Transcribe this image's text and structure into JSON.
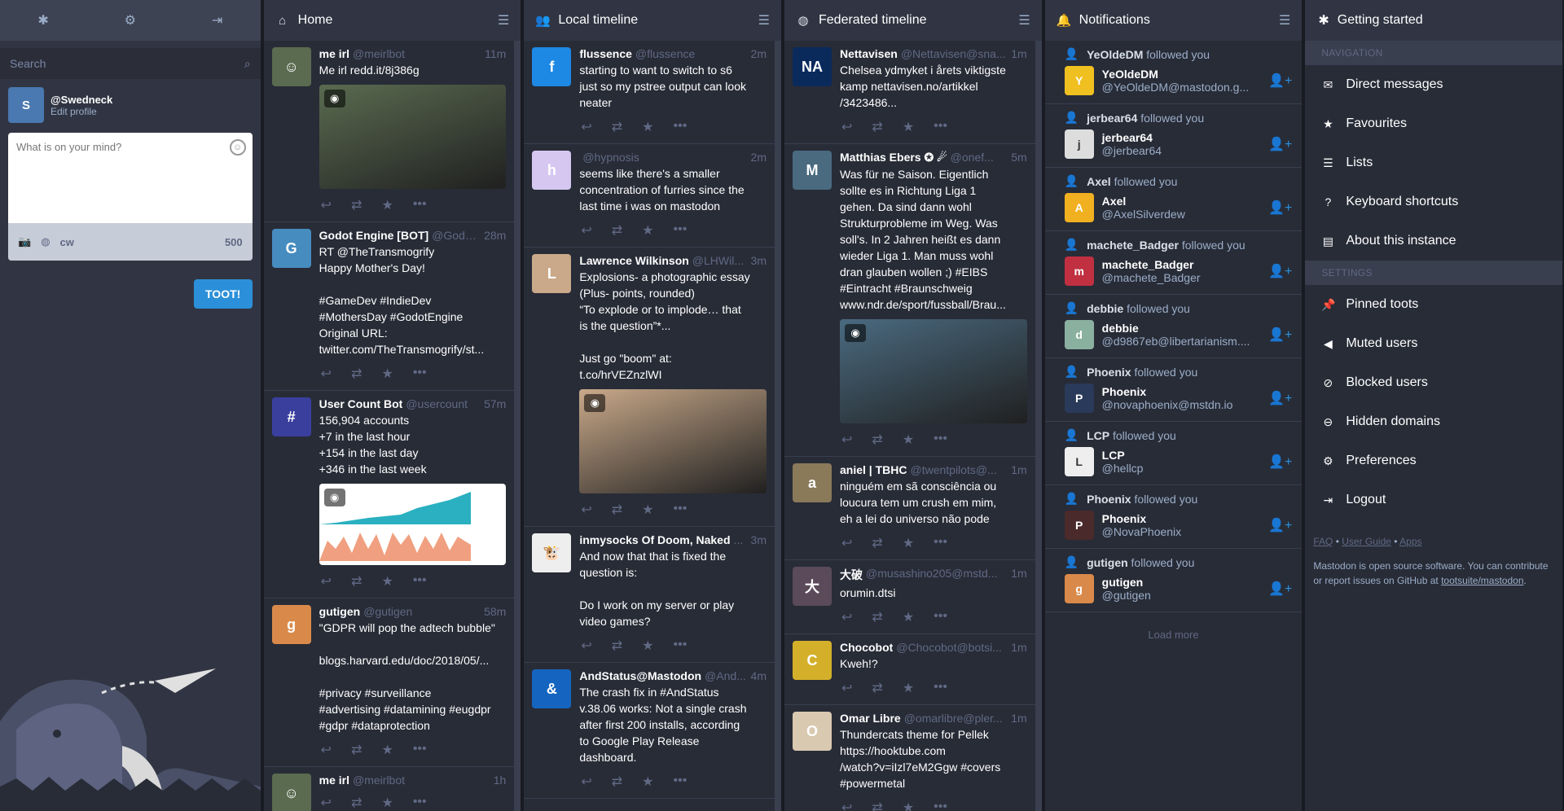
{
  "drawer": {
    "search_placeholder": "Search",
    "username": "@Swedneck",
    "edit_profile": "Edit profile",
    "compose_placeholder": "What is on your mind?",
    "cw": "cw",
    "char_count": "500",
    "toot_button": "TOOT!"
  },
  "columns": {
    "home": "Home",
    "local": "Local timeline",
    "federated": "Federated timeline",
    "notifications": "Notifications"
  },
  "home": [
    {
      "name": "me irl",
      "handle": "@meirlbot",
      "time": "11m",
      "text": "Me irl redd.it/8j386g",
      "media": true,
      "color": "#5a6b50",
      "avchar": "☺"
    },
    {
      "name": "Godot Engine [BOT]",
      "handle": "@Godot...",
      "time": "28m",
      "text": "RT @TheTransmogrify\nHappy Mother's Day!\n\n#GameDev #IndieDev\n#MothersDay #GodotEngine\nOriginal URL:\ntwitter.com/TheTransmogrify/st...",
      "media": false,
      "color": "#478cbf",
      "avchar": "G"
    },
    {
      "name": "User Count Bot",
      "handle": "@usercount",
      "time": "57m",
      "text": "156,904 accounts\n+7 in the last hour\n+154 in the last day\n+346 in the last week",
      "media": true,
      "color": "#3a3f9e",
      "avchar": "#"
    },
    {
      "name": "gutigen",
      "handle": "@gutigen",
      "time": "58m",
      "text": "\"GDPR will pop the adtech bubble\"\n\nblogs.harvard.edu/doc/2018/05/...\n\n#privacy #surveillance\n#advertising #datamining #eugdpr\n#gdpr #dataprotection",
      "media": false,
      "color": "#d98a4a",
      "avchar": "g"
    },
    {
      "name": "me irl",
      "handle": "@meirlbot",
      "time": "1h",
      "text": "",
      "media": false,
      "color": "#5a6b50",
      "avchar": "☺"
    }
  ],
  "local": [
    {
      "name": "flussence",
      "handle": "@flussence",
      "time": "2m",
      "text": "starting to want to switch to s6\njust so my pstree output can look\nneater",
      "media": false,
      "color": "#1e88e5",
      "avchar": "f"
    },
    {
      "name": "",
      "handle": "@hypnosis",
      "time": "2m",
      "text": "seems like there's a smaller\nconcentration of furries since the\nlast time i was on mastodon",
      "media": false,
      "color": "#d6c7f0",
      "avchar": "h"
    },
    {
      "name": "Lawrence Wilkinson",
      "handle": "@LHWil...",
      "time": "3m",
      "text": "Explosions- a photographic essay\n(Plus- points, rounded)\n“To explode or to implode… that\nis the question”*...\n\nJust go \"boom\" at:\nt.co/hrVEZnzlWI",
      "media": true,
      "color": "#c9a98a",
      "avchar": "L"
    },
    {
      "name": "inmysocks Of Doom, Naked",
      "handle": "...",
      "time": "3m",
      "text": "And now that that is fixed the\nquestion is:\n\nDo I work on my server or play\nvideo games?",
      "media": false,
      "color": "#eeeeee",
      "avchar": "🐮"
    },
    {
      "name": "AndStatus@Mastodon",
      "handle": "@And...",
      "time": "4m",
      "text": "The crash fix in #AndStatus\nv.38.06 works: Not a single crash\nafter first 200 installs, according\nto Google Play Release\ndashboard.",
      "media": false,
      "color": "#1565c0",
      "avchar": "&"
    }
  ],
  "federated": [
    {
      "name": "Nettavisen",
      "handle": "@Nettavisen@sna...",
      "time": "1m",
      "text": "Chelsea ydmyket i årets viktigste\nkamp nettavisen.no/artikkel\n/3423486...",
      "media": false,
      "color": "#0b2a5c",
      "avchar": "NA"
    },
    {
      "name": "Matthias Ebers ✪ ☄",
      "handle": "@onef...",
      "time": "5m",
      "text": "Was für ne Saison. Eigentlich\nsollte es in Richtung Liga 1\ngehen. Da sind dann wohl\nStrukturprobleme im Weg. Was\nsoll's. In 2 Jahren heißt es dann\nwieder Liga 1. Man muss wohl\ndran glauben wollen ;) #EIBS\n#Eintracht #Braunschweig\nwww.ndr.de/sport/fussball/Brau...",
      "media": true,
      "color": "#4a6a80",
      "avchar": "M"
    },
    {
      "name": "aniel | TBHC",
      "handle": "@twentpilots@...",
      "time": "1m",
      "text": "ninguém em sã consciência ou\nloucura tem um crush em mim,\neh a lei do universo não pode",
      "media": false,
      "color": "#8a7a5a",
      "avchar": "a"
    },
    {
      "name": "大破",
      "handle": "@musashino205@mstd...",
      "time": "1m",
      "text": "orumin.dtsi",
      "media": false,
      "color": "#5a4a5a",
      "avchar": "大"
    },
    {
      "name": "Chocobot",
      "handle": "@Chocobot@botsi...",
      "time": "1m",
      "text": "Kweh!?",
      "media": false,
      "color": "#d4b02a",
      "avchar": "C"
    },
    {
      "name": "Omar Libre",
      "handle": "@omarlibre@pler...",
      "time": "1m",
      "text": "Thundercats theme for Pellek\nhttps://hooktube.com\n/watch?v=iIzl7eM2Ggw #covers\n#powermetal",
      "media": false,
      "color": "#d9c9b0",
      "avchar": "O"
    }
  ],
  "notifications": [
    {
      "who": "YeOldeDM",
      "label": "followed you",
      "name": "YeOldeDM",
      "acct": "@YeOldeDM@mastodon.g...",
      "color": "#f0c020"
    },
    {
      "who": "jerbear64",
      "label": "followed you",
      "name": "jerbear64",
      "acct": "@jerbear64",
      "color": "#dddddd"
    },
    {
      "who": "Axel",
      "label": "followed you",
      "name": "Axel",
      "acct": "@AxelSilverdew",
      "color": "#f0b020"
    },
    {
      "who": "machete_Badger",
      "label": "followed you",
      "name": "machete_Badger",
      "acct": "@machete_Badger",
      "color": "#c03040"
    },
    {
      "who": "debbie",
      "label": "followed you",
      "name": "debbie",
      "acct": "@d9867eb@libertarianism....",
      "color": "#8ab0a0"
    },
    {
      "who": "Phoenix",
      "label": "followed you",
      "name": "Phoenix",
      "acct": "@novaphoenix@mstdn.io",
      "color": "#2a3a5a"
    },
    {
      "who": "LCP",
      "label": "followed you",
      "name": "LCP",
      "acct": "@hellcp",
      "color": "#eeeeee"
    },
    {
      "who": "Phoenix",
      "label": "followed you",
      "name": "Phoenix",
      "acct": "@NovaPhoenix",
      "color": "#4a2a2a"
    },
    {
      "who": "gutigen",
      "label": "followed you",
      "name": "gutigen",
      "acct": "@gutigen",
      "color": "#d98a4a"
    }
  ],
  "load_more": "Load more",
  "getting_started": {
    "title": "Getting started",
    "nav_header": "NAVIGATION",
    "nav": [
      "Direct messages",
      "Favourites",
      "Lists",
      "Keyboard shortcuts",
      "About this instance"
    ],
    "settings_header": "SETTINGS",
    "settings": [
      "Pinned toots",
      "Muted users",
      "Blocked users",
      "Hidden domains",
      "Preferences",
      "Logout"
    ],
    "links": [
      "FAQ",
      "User Guide",
      "Apps"
    ],
    "about": "Mastodon is open source software. You can contribute or report issues on GitHub at",
    "repo": "tootsuite/mastodon"
  },
  "colors": {
    "accent": "#2b90d9",
    "bg": "#282c37",
    "drawer": "#313543"
  }
}
